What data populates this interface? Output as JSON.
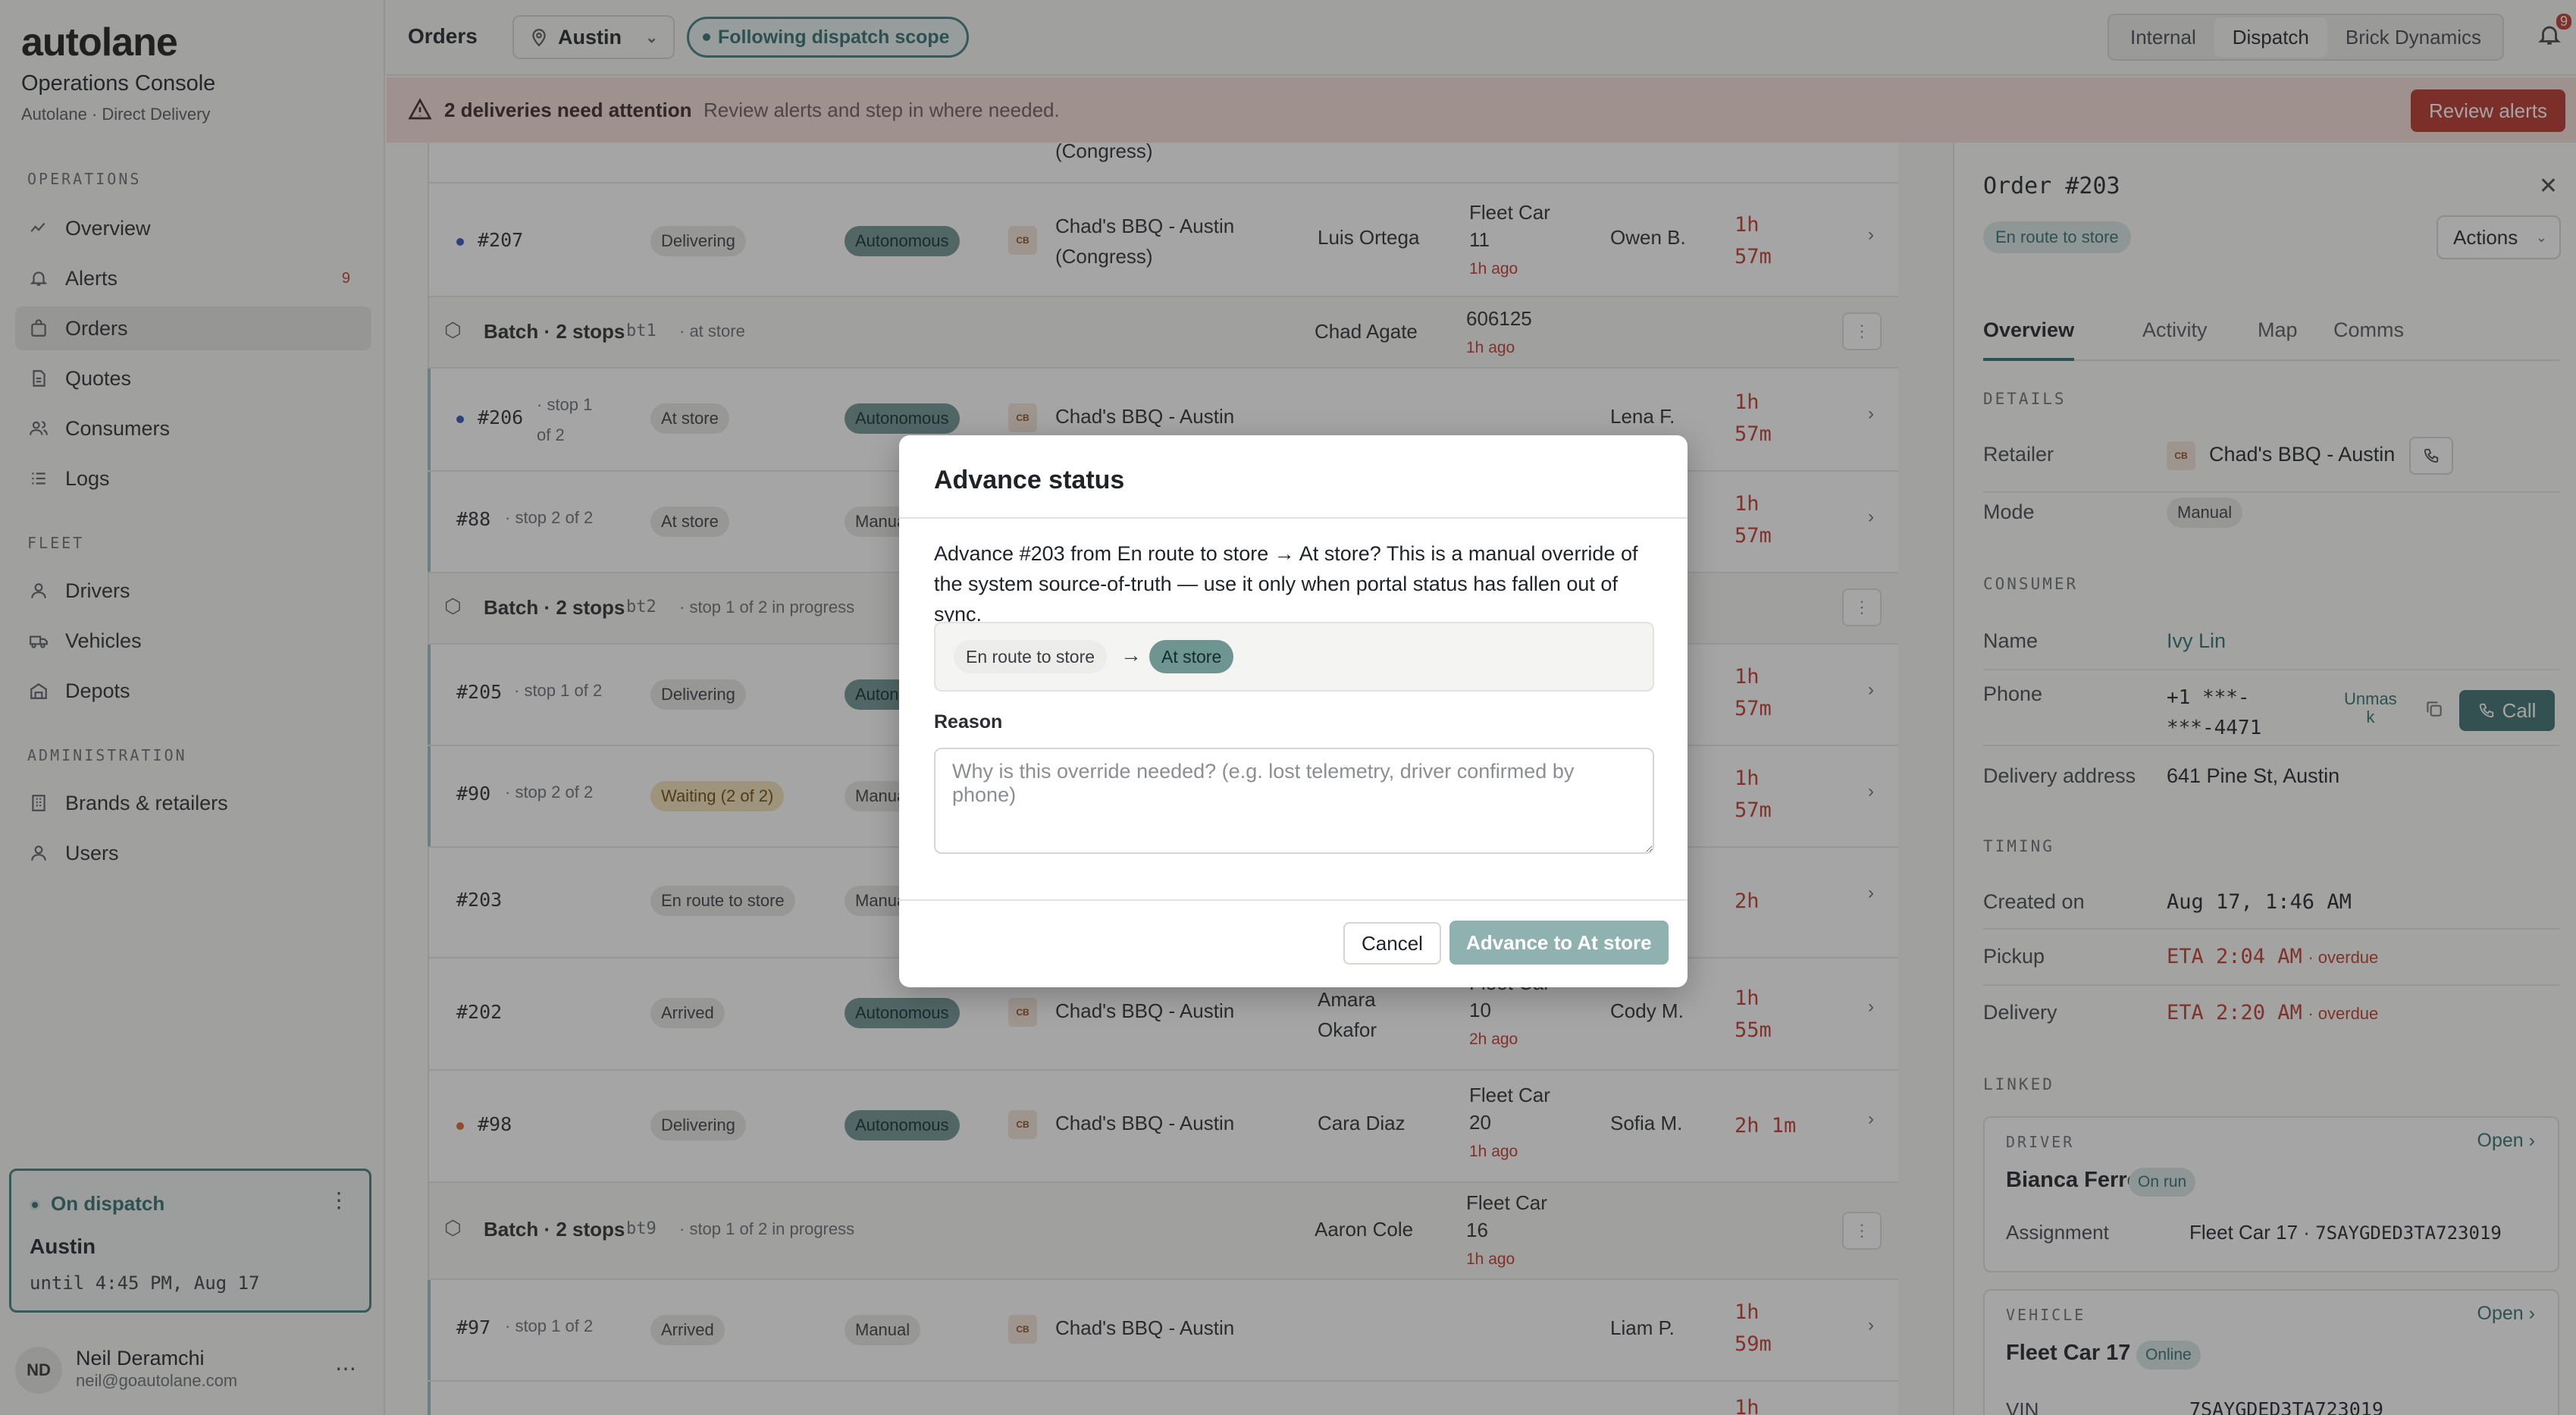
{
  "sidebar": {
    "logo": "autolane",
    "console_title": "Operations Console",
    "console_sub": "Autolane · Direct Delivery",
    "sections": {
      "operations": "OPERATIONS",
      "fleet": "FLEET",
      "administration": "ADMINISTRATION"
    },
    "items": [
      {
        "label": "Overview",
        "icon": "grid-icon"
      },
      {
        "label": "Alerts",
        "icon": "bell-icon",
        "badge": "9"
      },
      {
        "label": "Orders",
        "icon": "bag-icon",
        "active": true
      },
      {
        "label": "Quotes",
        "icon": "document-icon"
      },
      {
        "label": "Consumers",
        "icon": "users-icon"
      },
      {
        "label": "Logs",
        "icon": "list-icon"
      },
      {
        "label": "Drivers",
        "icon": "user-icon"
      },
      {
        "label": "Vehicles",
        "icon": "truck-icon"
      },
      {
        "label": "Depots",
        "icon": "warehouse-icon"
      },
      {
        "label": "Brands & retailers",
        "icon": "building-icon"
      },
      {
        "label": "Users",
        "icon": "user-icon"
      }
    ],
    "dispatch": {
      "status": "On dispatch",
      "city": "Austin",
      "until": "until 4:45 PM, Aug 17"
    },
    "user": {
      "initials": "ND",
      "name": "Neil Deramchi",
      "email": "neil@goautolane.com"
    }
  },
  "topbar": {
    "title": "Orders",
    "location": "Austin",
    "scope": "Following dispatch scope",
    "segments": [
      "Internal",
      "Dispatch",
      "Brick Dynamics"
    ],
    "active_segment": "Dispatch",
    "notification_count": "9"
  },
  "banner": {
    "title": "2 deliveries need attention",
    "text": "Review alerts and step in where needed.",
    "button": "Review alerts"
  },
  "orders": {
    "top_partial": "(Congress)",
    "rows": [
      {
        "id": "#207",
        "status": "Delivering",
        "mode": "Autonomous",
        "store": "Chad's BBQ - Austin",
        "store2": "(Congress)",
        "driver": "Luis Ortega",
        "vehicle": "Fleet Car",
        "vehicle2": "11",
        "ago": "1h ago",
        "consumer": "Owen B.",
        "time1": "1h",
        "time2": "57m"
      },
      {
        "batch": "Batch · 2 stops",
        "code": "bt1",
        "note": "· at store",
        "driver": "Chad Agate",
        "vehicle": "606125",
        "ago": "1h ago"
      },
      {
        "id": "#206",
        "stop": "· stop 1",
        "stop2": "of 2",
        "status": "At store",
        "mode": "Autonomous",
        "store": "Chad's BBQ - Austin",
        "consumer": "Lena F.",
        "time1": "1h",
        "time2": "57m"
      },
      {
        "id": "#88",
        "stop": "· stop 2 of 2",
        "status": "At store",
        "mode": "Manual",
        "time1": "1h",
        "time2": "57m"
      },
      {
        "batch": "Batch · 2 stops",
        "code": "bt2",
        "note": "· stop 1 of 2 in progress"
      },
      {
        "id": "#205",
        "stop": "· stop 1 of 2",
        "status": "Delivering",
        "mode": "Autonomous",
        "time1": "1h",
        "time2": "57m"
      },
      {
        "id": "#90",
        "stop": "· stop 2 of 2",
        "status": "Waiting (2 of 2)",
        "mode": "Manual",
        "time1": "1h",
        "time2": "57m"
      },
      {
        "id": "#203",
        "status": "En route to store",
        "mode": "Manual",
        "time1": "2h"
      },
      {
        "id": "#202",
        "status": "Arrived",
        "mode": "Autonomous",
        "store": "Chad's BBQ - Austin",
        "driver": "Amara",
        "driver2": "Okafor",
        "vehicle": "Fleet Car",
        "vehicle2": "10",
        "ago": "2h ago",
        "consumer": "Cody M.",
        "time1": "1h",
        "time2": "55m"
      },
      {
        "id": "#98",
        "status": "Delivering",
        "mode": "Autonomous",
        "store": "Chad's BBQ - Austin",
        "driver": "Cara Diaz",
        "vehicle": "Fleet Car",
        "vehicle2": "20",
        "ago": "1h ago",
        "consumer": "Sofia M.",
        "time1": "2h 1m"
      },
      {
        "batch": "Batch · 2 stops",
        "code": "bt9",
        "note": "· stop 1 of 2 in progress",
        "driver": "Aaron Cole",
        "vehicle": "Fleet Car",
        "vehicle2": "16",
        "ago": "1h ago"
      },
      {
        "id": "#97",
        "stop": "· stop 1 of 2",
        "status": "Arrived",
        "mode": "Manual",
        "store": "Chad's BBQ - Austin",
        "consumer": "Liam P.",
        "time1": "1h",
        "time2": "59m"
      },
      {
        "time1": "1h"
      }
    ],
    "store_logo": "CB"
  },
  "modal": {
    "title": "Advance status",
    "body": "Advance #203 from En route to store → At store? This is a manual override of the system source-of-truth — use it only when portal status has fallen out of sync.",
    "from": "En route to store",
    "to": "At store",
    "reason_label": "Reason",
    "reason_placeholder": "Why is this override needed? (e.g. lost telemetry, driver confirmed by phone)",
    "cancel": "Cancel",
    "confirm": "Advance to At store"
  },
  "detail": {
    "title": "Order #203",
    "status": "En route to store",
    "actions": "Actions",
    "tabs": [
      "Overview",
      "Activity",
      "Map",
      "Comms"
    ],
    "sections": {
      "details": "DETAILS",
      "consumer": "CONSUMER",
      "timing": "TIMING",
      "linked": "LINKED"
    },
    "retailer_label": "Retailer",
    "retailer": "Chad's BBQ - Austin",
    "mode_label": "Mode",
    "mode": "Manual",
    "name_label": "Name",
    "name": "Ivy Lin",
    "phone_label": "Phone",
    "phone1": "+1 ***-",
    "phone2": "***-4471",
    "unmask1": "Unmas",
    "unmask2": "k",
    "call": "Call",
    "address_label": "Delivery address",
    "address": "641 Pine St, Austin",
    "created_label": "Created on",
    "created": "Aug 17, 1:46 AM",
    "pickup_label": "Pickup",
    "pickup": "ETA 2:04 AM",
    "delivery_label": "Delivery",
    "delivery": "ETA 2:20 AM",
    "overdue": "· overdue",
    "driver_card": {
      "head": "DRIVER",
      "open": "Open",
      "name": "Bianca Ferro",
      "pill": "On run",
      "assign_label": "Assignment",
      "assign": "Fleet Car 17 · ",
      "assign_vin": "7SAYGDED3TA723019"
    },
    "vehicle_card": {
      "head": "VEHICLE",
      "open": "Open",
      "name": "Fleet Car 17",
      "pill": "Online",
      "vin_label": "VIN",
      "vin": "7SAYGDED3TA723019"
    }
  }
}
